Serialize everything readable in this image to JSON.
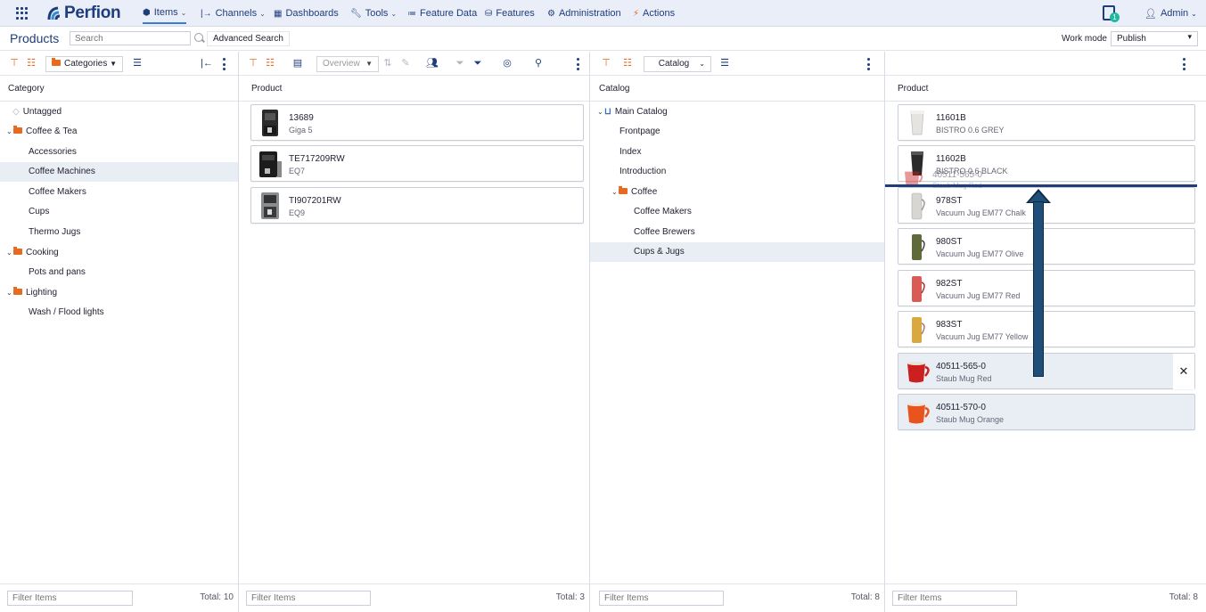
{
  "nav": {
    "logo_text": "Perfion",
    "items": [
      {
        "label": "Items",
        "icon": "cube-icon",
        "has_caret": true,
        "active": true
      },
      {
        "label": "Channels",
        "icon": "channels-icon",
        "has_caret": true
      },
      {
        "label": "Dashboards",
        "icon": "dashboard-icon",
        "has_caret": false
      },
      {
        "label": "Tools",
        "icon": "wrench-icon",
        "has_caret": true
      },
      {
        "label": "Feature Data",
        "icon": "list-icon",
        "has_caret": false
      },
      {
        "label": "Features",
        "icon": "database-icon",
        "has_caret": false
      },
      {
        "label": "Administration",
        "icon": "gear-icon",
        "has_caret": false
      },
      {
        "label": "Actions",
        "icon": "actions-icon",
        "has_caret": false
      }
    ],
    "notification_count": "1",
    "user_label": "Admin"
  },
  "header": {
    "title": "Products",
    "search_placeholder": "Search",
    "advanced_search_label": "Advanced Search",
    "work_mode_label": "Work mode",
    "work_mode_value": "Publish"
  },
  "panel1": {
    "dropdown_label": "Categories",
    "column_header": "Category",
    "tree": [
      {
        "label": "Untagged",
        "type": "tag",
        "level": 0
      },
      {
        "label": "Coffee & Tea",
        "type": "folder",
        "level": 0,
        "expanded": true
      },
      {
        "label": "Accessories",
        "type": "leaf",
        "level": 1
      },
      {
        "label": "Coffee Machines",
        "type": "leaf",
        "level": 1,
        "selected": true
      },
      {
        "label": "Coffee Makers",
        "type": "leaf",
        "level": 1
      },
      {
        "label": "Cups",
        "type": "leaf",
        "level": 1
      },
      {
        "label": "Thermo Jugs",
        "type": "leaf",
        "level": 1
      },
      {
        "label": "Cooking",
        "type": "folder",
        "level": 0,
        "expanded": true
      },
      {
        "label": "Pots and pans",
        "type": "leaf",
        "level": 1
      },
      {
        "label": "Lighting",
        "type": "folder",
        "level": 0,
        "expanded": true
      },
      {
        "label": "Wash / Flood lights",
        "type": "leaf",
        "level": 1
      }
    ],
    "filter_placeholder": "Filter Items",
    "total": "Total: 10"
  },
  "panel2": {
    "view_dropdown": "Overview",
    "column_header": "Product",
    "products": [
      {
        "code": "13689",
        "name": "Giga 5"
      },
      {
        "code": "TE717209RW",
        "name": "EQ7"
      },
      {
        "code": "TI907201RW",
        "name": "EQ9"
      }
    ],
    "filter_placeholder": "Filter Items",
    "total": "Total: 3"
  },
  "panel3": {
    "dropdown_label": "Catalog",
    "column_header": "Catalog",
    "tree": [
      {
        "label": "Main Catalog",
        "type": "catalog",
        "level": 0
      },
      {
        "label": "Frontpage",
        "type": "leaf",
        "level": 1
      },
      {
        "label": "Index",
        "type": "leaf",
        "level": 1
      },
      {
        "label": "Introduction",
        "type": "leaf",
        "level": 1
      },
      {
        "label": "Coffee",
        "type": "folder",
        "level": 1
      },
      {
        "label": "Coffee Makers",
        "type": "leaf",
        "level": 2
      },
      {
        "label": "Coffee Brewers",
        "type": "leaf",
        "level": 2
      },
      {
        "label": "Cups & Jugs",
        "type": "leaf",
        "level": 2,
        "selected": true
      }
    ],
    "filter_placeholder": "Filter Items",
    "total": "Total: 8"
  },
  "panel4": {
    "column_header": "Product",
    "products": [
      {
        "code": "11601B",
        "name": "BISTRO 0.6 GREY",
        "color": "#e6e4e0"
      },
      {
        "code": "11602B",
        "name": "BISTRO 0.6 BLACK",
        "color": "#2a2a2a"
      },
      {
        "code": "978ST",
        "name": "Vacuum Jug EM77 Chalk",
        "color": "#d8d6d0"
      },
      {
        "code": "980ST",
        "name": "Vacuum Jug EM77 Olive",
        "color": "#5e6a3a"
      },
      {
        "code": "982ST",
        "name": "Vacuum Jug EM77 Red",
        "color": "#d95b55"
      },
      {
        "code": "983ST",
        "name": "Vacuum Jug EM77 Yellow",
        "color": "#d9a940"
      },
      {
        "code": "40511-565-0",
        "name": "Staub Mug Red",
        "color": "#cc1f1f",
        "selected": true
      },
      {
        "code": "40511-570-0",
        "name": "Staub Mug Orange",
        "color": "#e8531e",
        "selected": true
      }
    ],
    "drag_ghost": {
      "code": "40511-565-0",
      "name": "Staub Mug Red"
    },
    "filter_placeholder": "Filter Items",
    "total": "Total: 8"
  }
}
